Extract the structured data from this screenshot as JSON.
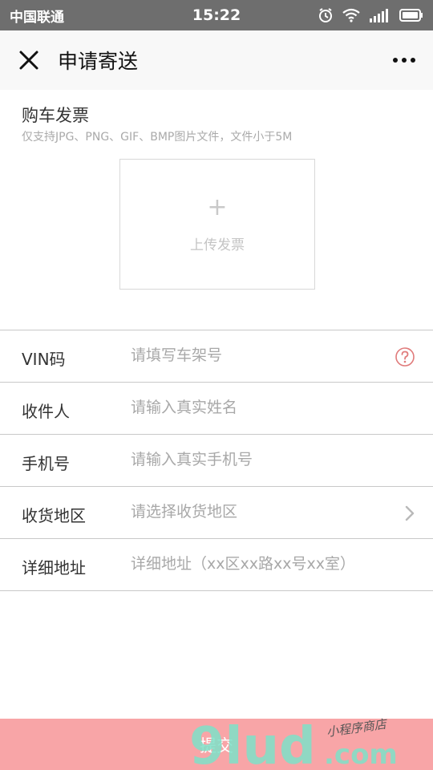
{
  "status_bar": {
    "carrier": "中国联通",
    "time": "15:22"
  },
  "header": {
    "title": "申请寄送"
  },
  "invoice": {
    "label": "购车发票",
    "hint": "仅支持JPG、PNG、GIF、BMP图片文件，文件小于5M",
    "upload_plus": "+",
    "upload_label": "上传发票"
  },
  "form": {
    "vin": {
      "label": "VIN码",
      "placeholder": "请填写车架号"
    },
    "recipient": {
      "label": "收件人",
      "placeholder": "请输入真实姓名"
    },
    "phone": {
      "label": "手机号",
      "placeholder": "请输入真实手机号"
    },
    "region": {
      "label": "收货地区",
      "placeholder": "请选择收货地区"
    },
    "address": {
      "label": "详细地址",
      "placeholder": "详细地址（xx区xx路xx号xx室）"
    }
  },
  "submit": {
    "label": "提交"
  },
  "watermark": {
    "brand": "9lud",
    "domain": ".com",
    "tagline": "小程序商店"
  },
  "colors": {
    "accent": "#f8a5a7",
    "help_icon": "#e07b7b",
    "status_bar": "#6e6e6e"
  },
  "icons": [
    "close-icon",
    "more-icon",
    "plus-icon",
    "help-icon",
    "chevron-right-icon",
    "wifi-icon",
    "signal-icon",
    "battery-icon",
    "alarm-icon"
  ]
}
